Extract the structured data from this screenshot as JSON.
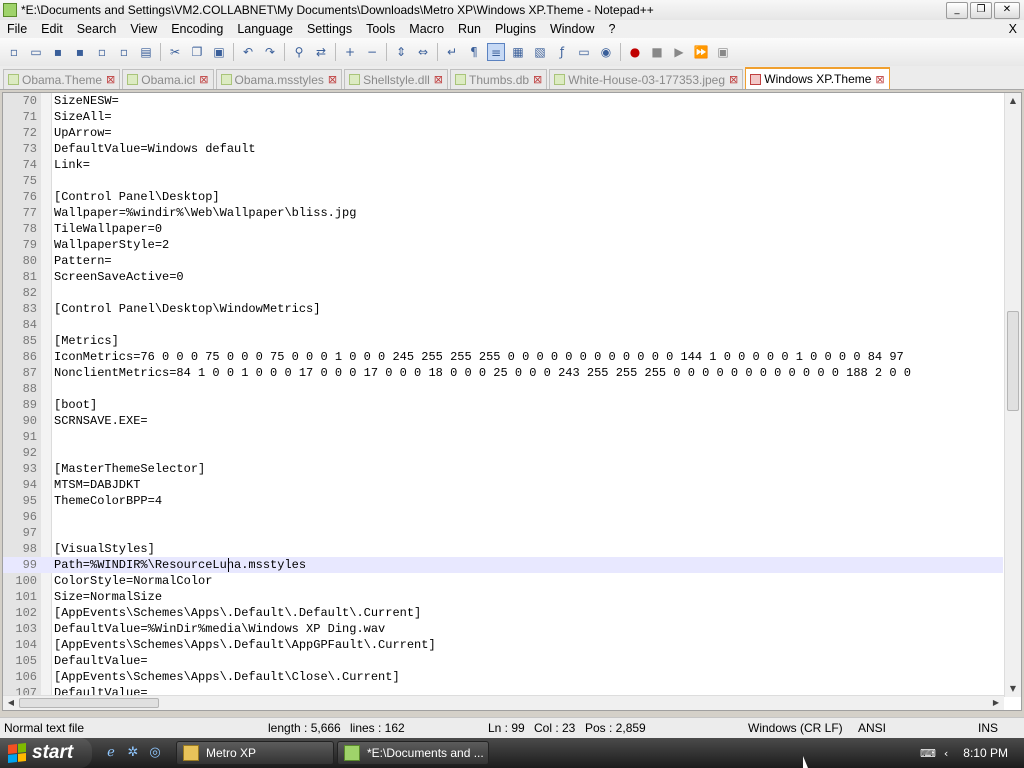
{
  "window": {
    "title": "*E:\\Documents and Settings\\VM2.COLLABNET\\My Documents\\Downloads\\Metro XP\\Windows XP.Theme - Notepad++",
    "minimize": "_",
    "maximize": "❐",
    "close": "✕"
  },
  "menu": {
    "items": [
      "File",
      "Edit",
      "Search",
      "View",
      "Encoding",
      "Language",
      "Settings",
      "Tools",
      "Macro",
      "Run",
      "Plugins",
      "Window",
      "?"
    ],
    "close_doc": "X"
  },
  "tabs": [
    {
      "label": "Obama.Theme",
      "active": false
    },
    {
      "label": "Obama.icl",
      "active": false
    },
    {
      "label": "Obama.msstyles",
      "active": false
    },
    {
      "label": "Shellstyle.dll",
      "active": false
    },
    {
      "label": "Thumbs.db",
      "active": false
    },
    {
      "label": "White-House-03-177353.jpeg",
      "active": false
    },
    {
      "label": "Windows XP.Theme",
      "active": true
    }
  ],
  "editor": {
    "lines": [
      {
        "n": "70",
        "t": "SizeNESW="
      },
      {
        "n": "71",
        "t": "SizeAll="
      },
      {
        "n": "72",
        "t": "UpArrow="
      },
      {
        "n": "73",
        "t": "DefaultValue=Windows default"
      },
      {
        "n": "74",
        "t": "Link="
      },
      {
        "n": "75",
        "t": ""
      },
      {
        "n": "76",
        "t": "[Control Panel\\Desktop]"
      },
      {
        "n": "77",
        "t": "Wallpaper=%windir%\\Web\\Wallpaper\\bliss.jpg"
      },
      {
        "n": "78",
        "t": "TileWallpaper=0"
      },
      {
        "n": "79",
        "t": "WallpaperStyle=2"
      },
      {
        "n": "80",
        "t": "Pattern="
      },
      {
        "n": "81",
        "t": "ScreenSaveActive=0"
      },
      {
        "n": "82",
        "t": ""
      },
      {
        "n": "83",
        "t": "[Control Panel\\Desktop\\WindowMetrics]"
      },
      {
        "n": "84",
        "t": ""
      },
      {
        "n": "85",
        "t": "[Metrics]"
      },
      {
        "n": "86",
        "t": "IconMetrics=76 0 0 0 75 0 0 0 75 0 0 0 1 0 0 0 245 255 255 255 0 0 0 0 0 0 0 0 0 0 0 0 144 1 0 0 0 0 0 1 0 0 0 0 84 97"
      },
      {
        "n": "87",
        "t": "NonclientMetrics=84 1 0 0 1 0 0 0 17 0 0 0 17 0 0 0 18 0 0 0 25 0 0 0 243 255 255 255 0 0 0 0 0 0 0 0 0 0 0 0 188 2 0 0"
      },
      {
        "n": "88",
        "t": ""
      },
      {
        "n": "89",
        "t": "[boot]"
      },
      {
        "n": "90",
        "t": "SCRNSAVE.EXE="
      },
      {
        "n": "91",
        "t": ""
      },
      {
        "n": "92",
        "t": ""
      },
      {
        "n": "93",
        "t": "[MasterThemeSelector]"
      },
      {
        "n": "94",
        "t": "MTSM=DABJDKT"
      },
      {
        "n": "95",
        "t": "ThemeColorBPP=4"
      },
      {
        "n": "96",
        "t": ""
      },
      {
        "n": "97",
        "t": ""
      },
      {
        "n": "98",
        "t": "[VisualStyles]"
      },
      {
        "n": "99",
        "t": "Path=%WINDIR%\\ResourceLuna.msstyles",
        "current": true
      },
      {
        "n": "100",
        "t": "ColorStyle=NormalColor"
      },
      {
        "n": "101",
        "t": "Size=NormalSize"
      },
      {
        "n": "102",
        "t": "[AppEvents\\Schemes\\Apps\\.Default\\.Default\\.Current]"
      },
      {
        "n": "103",
        "t": "DefaultValue=%WinDir%media\\Windows XP Ding.wav"
      },
      {
        "n": "104",
        "t": "[AppEvents\\Schemes\\Apps\\.Default\\AppGPFault\\.Current]"
      },
      {
        "n": "105",
        "t": "DefaultValue="
      },
      {
        "n": "106",
        "t": "[AppEvents\\Schemes\\Apps\\.Default\\Close\\.Current]"
      },
      {
        "n": "107",
        "t": "DefaultValue="
      }
    ]
  },
  "status": {
    "filetype": "Normal text file",
    "length": "length : 5,666",
    "lines": "lines : 162",
    "ln": "Ln : 99",
    "col": "Col : 23",
    "pos": "Pos : 2,859",
    "eol": "Windows (CR LF)",
    "encoding": "ANSI",
    "mode": "INS"
  },
  "taskbar": {
    "start_label": "start",
    "tasks": [
      {
        "label": "Metro XP"
      },
      {
        "label": "*E:\\Documents and ..."
      }
    ],
    "clock": "8:10 PM"
  },
  "colors": {
    "tab_active_accent": "#f0a030",
    "current_line": "#e8e8ff",
    "taskbar": "#2b2b2b"
  }
}
